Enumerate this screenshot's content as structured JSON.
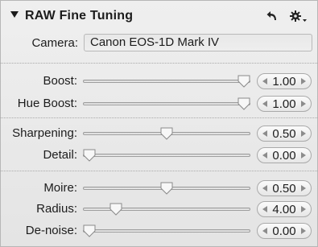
{
  "panel": {
    "title": "RAW Fine Tuning",
    "camera_label": "Camera:",
    "camera_value": "Canon EOS-1D Mark IV"
  },
  "sliders": [
    {
      "label": "Boost:",
      "value": "1.00",
      "fraction": 1.0
    },
    {
      "label": "Hue Boost:",
      "value": "1.00",
      "fraction": 1.0
    },
    {
      "label": "Sharpening:",
      "value": "0.50",
      "fraction": 0.5
    },
    {
      "label": "Detail:",
      "value": "0.00",
      "fraction": 0.0
    },
    {
      "label": "Moire:",
      "value": "0.50",
      "fraction": 0.5
    },
    {
      "label": "Radius:",
      "value": "4.00",
      "fraction": 0.17
    },
    {
      "label": "De-noise:",
      "value": "0.00",
      "fraction": 0.0
    }
  ],
  "icons": {
    "collapse": "disclosure-triangle-down",
    "reset": "undo-arrow",
    "action": "gear-with-dropdown"
  }
}
